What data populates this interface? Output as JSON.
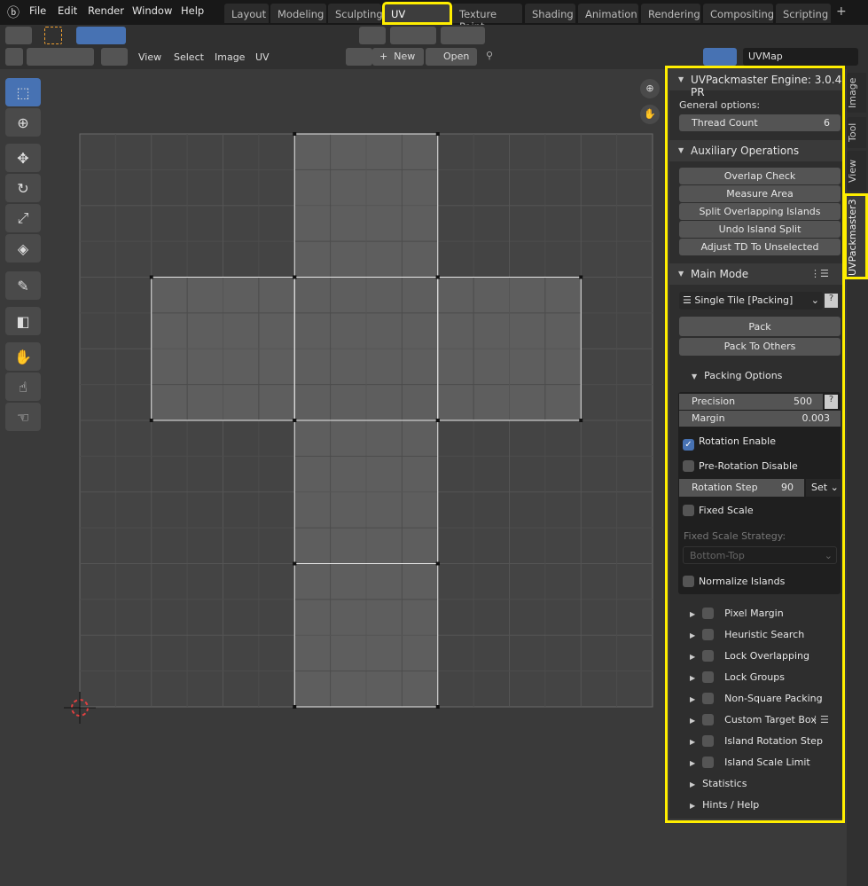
{
  "menubar": {
    "items": [
      "File",
      "Edit",
      "Render",
      "Window",
      "Help"
    ]
  },
  "workspaces": [
    {
      "label": "Layout"
    },
    {
      "label": "Modeling"
    },
    {
      "label": "Sculpting"
    },
    {
      "label": "UV Editing",
      "active": true
    },
    {
      "label": "Texture Paint"
    },
    {
      "label": "Shading"
    },
    {
      "label": "Animation"
    },
    {
      "label": "Rendering"
    },
    {
      "label": "Compositing"
    },
    {
      "label": "Scripting"
    }
  ],
  "header": {
    "menus": [
      "View",
      "Select",
      "Image",
      "UV"
    ],
    "new_label": "New",
    "open_label": "Open",
    "uvmap": "UVMap"
  },
  "panel": {
    "engine_title": "UVPackmaster Engine: 3.0.4 PR",
    "general_options": "General options:",
    "thread_count_label": "Thread Count",
    "thread_count": "6",
    "aux_title": "Auxiliary Operations",
    "aux_buttons": [
      "Overlap Check",
      "Measure Area",
      "Split Overlapping Islands",
      "Undo Island Split",
      "Adjust TD To Unselected"
    ],
    "main_mode_title": "Main Mode",
    "mode_select": "Single Tile [Packing]",
    "pack": "Pack",
    "pack_to_others": "Pack To Others",
    "packing_options": "Packing Options",
    "precision_label": "Precision",
    "precision": "500",
    "margin_label": "Margin",
    "margin": "0.003",
    "rotation_enable": "Rotation Enable",
    "rotation_enable_checked": true,
    "pre_rotation_disable": "Pre-Rotation Disable",
    "rotation_step_label": "Rotation Step",
    "rotation_step": "90",
    "set_label": "Set",
    "fixed_scale": "Fixed Scale",
    "fixed_scale_strategy": "Fixed Scale Strategy:",
    "fixed_scale_strategy_value": "Bottom-Top",
    "normalize_islands": "Normalize Islands",
    "subpanels": [
      "Pixel Margin",
      "Heuristic Search",
      "Lock Overlapping",
      "Lock Groups",
      "Non-Square Packing",
      "Custom Target Box",
      "Island Rotation Step",
      "Island Scale Limit"
    ],
    "statistics": "Statistics",
    "hints": "Hints / Help"
  },
  "side_tabs": [
    "Image",
    "Tool",
    "View",
    "UVPackmaster3"
  ],
  "colors": {
    "highlight": "#ffee00",
    "accent": "#4772b3"
  }
}
